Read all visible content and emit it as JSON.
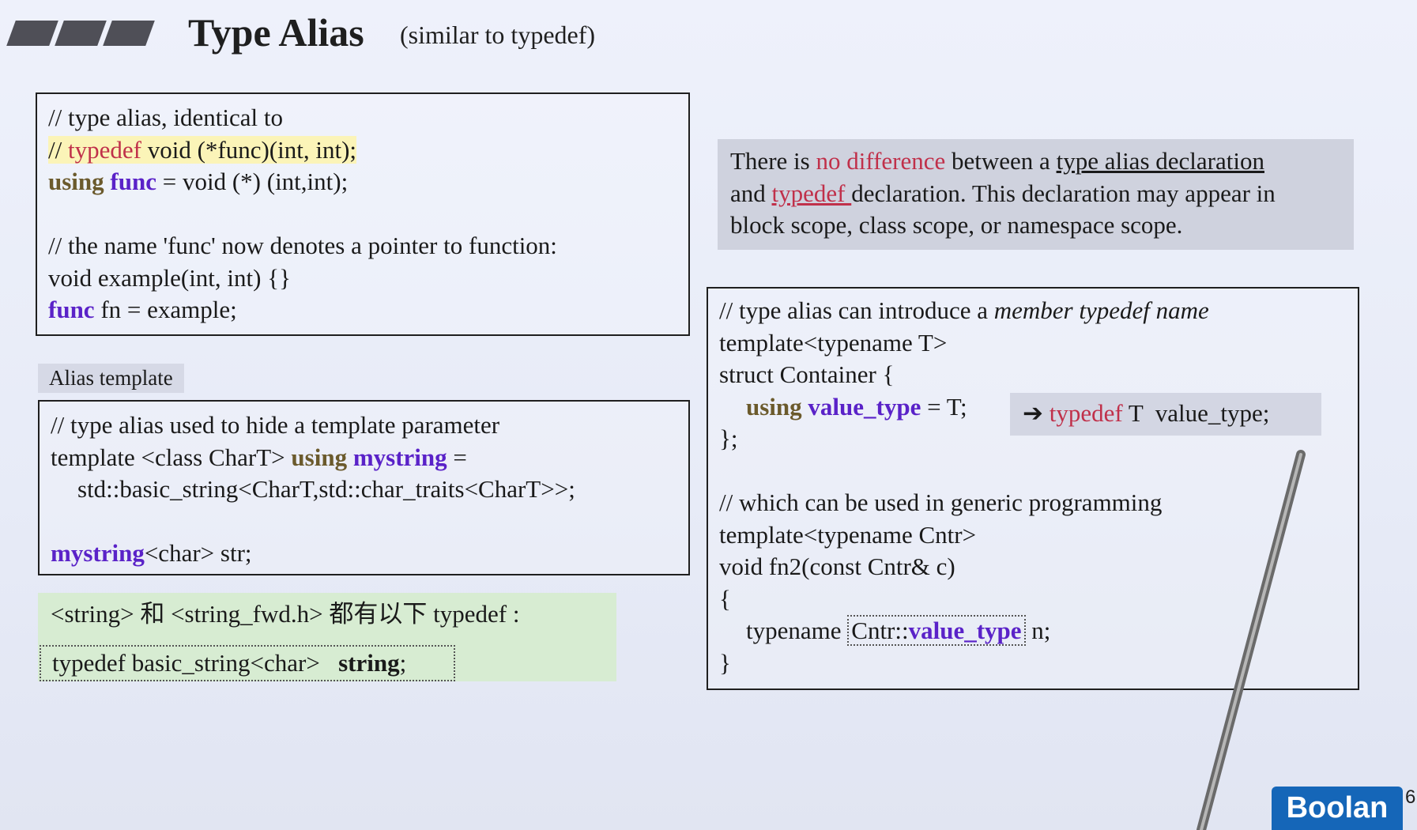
{
  "header": {
    "title": "Type Alias",
    "subtitle": "(similar to typedef)"
  },
  "box1": {
    "l1": "// type alias, identical to",
    "l2a": "// ",
    "l2b": "typedef",
    "l2c": " void (*func)(int, int);",
    "l3a": "using",
    "l3b": "func",
    "l3c": " = void (*) (int,int);",
    "l4": "// the name 'func' now denotes a pointer to function:",
    "l5": "void example(int, int) {}",
    "l6a": "func",
    "l6b": " fn = example;"
  },
  "alias_template_label": "Alias template",
  "box2": {
    "l1": "// type alias used to hide a template parameter",
    "l2a": "template <class CharT> ",
    "l2b": "using",
    "l2c": "mystring",
    "l2d": " =",
    "l3": "std::basic_string<CharT,std::char_traits<CharT>>;",
    "l4a": "mystring",
    "l4b": "<char> str;"
  },
  "green": {
    "l1": "<string> 和 <string_fwd.h> 都有以下 typedef :",
    "l2a": "typedef basic_string<char>",
    "l2b": "string",
    "l2c": ";"
  },
  "note": {
    "a": "There is ",
    "b": "no difference",
    "c": " between a ",
    "d": "type alias declaration",
    "e": "and ",
    "f": "typedef ",
    "g": "declaration. This declaration may appear in",
    "h": "block scope, class scope, or namespace scope."
  },
  "box3": {
    "l1a": "// type alias can introduce a ",
    "l1b": "member typedef name",
    "l2": "template<typename T>",
    "l3": "struct Container {",
    "l4a": "using",
    "l4b": "value_type",
    "l4c": " = T;",
    "l5": "};",
    "l6": "// which can be used in generic programming",
    "l7": "template<typename Cntr>",
    "l8": "void fn2(const Cntr& c)",
    "l9": "{",
    "l10a": "typename ",
    "l10b": "Cntr::",
    "l10c": "value_type",
    "l10d": " n;",
    "l11": "}",
    "arrow_a": "typedef",
    "arrow_b": " T  value_type;"
  },
  "logo": "Boolan",
  "page_number": "6",
  "colors": {
    "keyword_purple": "#5a22c8",
    "keyword_olive": "#6b5a2c",
    "highlight_red": "#c0304a",
    "logo_blue": "#1566b8"
  }
}
